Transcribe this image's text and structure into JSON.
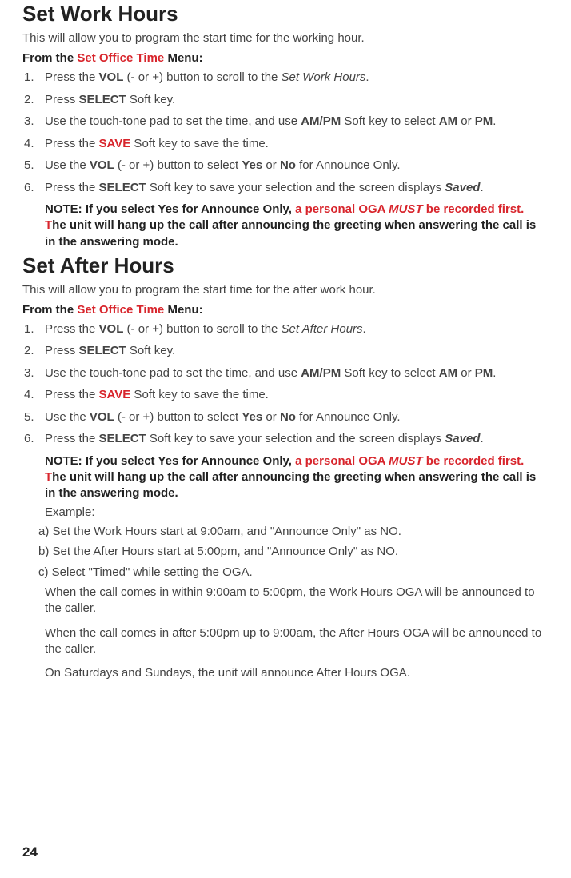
{
  "section1": {
    "title": "Set Work Hours",
    "intro": "This will allow you to program the start time for the working hour.",
    "menuFrom_pre": "From the ",
    "menuFrom_red": "Set Office Time",
    "menuFrom_post": " Menu:"
  },
  "s1_steps": {
    "s1": {
      "a": "Press the ",
      "b": "VOL",
      "c": " (- or +) button to scroll to the ",
      "d": "Set Work Hours",
      "e": "."
    },
    "s2": {
      "a": "Press ",
      "b": "SELECT",
      "c": " Soft key."
    },
    "s3": {
      "a": "Use the touch-tone pad to set the time, and use ",
      "b": "AM/PM",
      "c": " Soft key to select ",
      "d": "AM",
      "e": " or ",
      "f": "PM",
      "g": "."
    },
    "s4": {
      "a": "Press the ",
      "b": "SAVE",
      "c": " Soft key to save the time."
    },
    "s5": {
      "a": "Use the ",
      "b": "VOL",
      "c": " (- or +) button to select ",
      "d": "Yes",
      "e": " or ",
      "f": "No",
      "g": " for Announce Only."
    },
    "s6": {
      "a": "Press the ",
      "b": "SELECT",
      "c": " Soft key to save your selection and the screen displays ",
      "d": "Saved",
      "e": "."
    }
  },
  "note1": {
    "a": "NOTE: If you select Yes for Announce Only, ",
    "b": "a personal OGA ",
    "c": "MUST",
    "d": " be recorded first. T",
    "e": "he unit will hang up the call after announcing the greeting when answering the call is in the answering mode."
  },
  "section2": {
    "title": "Set After Hours",
    "intro": "This will allow you to program the start time for the after work hour.",
    "menuFrom_pre": "From the ",
    "menuFrom_red": "Set Office Time",
    "menuFrom_post": " Menu:"
  },
  "s2_steps": {
    "s1": {
      "a": "Press the ",
      "b": "VOL",
      "c": " (- or +) button to scroll to the ",
      "d": "Set After Hours",
      "e": "."
    },
    "s2": {
      "a": "Press ",
      "b": "SELECT",
      "c": " Soft key."
    },
    "s3": {
      "a": "Use the touch-tone pad to set the time, and use ",
      "b": "AM/PM",
      "c": " Soft key to select ",
      "d": "AM",
      "e": " or ",
      "f": "PM",
      "g": "."
    },
    "s4": {
      "a": "Press the ",
      "b": "SAVE",
      "c": " Soft key to save the time."
    },
    "s5": {
      "a": "Use the ",
      "b": "VOL",
      "c": " (- or +) button to select ",
      "d": "Yes",
      "e": " or ",
      "f": "No",
      "g": " for Announce Only."
    },
    "s6": {
      "a": "Press the ",
      "b": "SELECT",
      "c": " Soft key to save your selection and the screen displays ",
      "d": "Saved",
      "e": "."
    }
  },
  "note2": {
    "a": "NOTE: If you select Yes for Announce Only, ",
    "b": "a personal OGA ",
    "c": "MUST",
    "d": " be recorded first. T",
    "e": "he unit will hang up the call after announcing the greeting when answering the call is in the answering mode."
  },
  "example": {
    "label": "Example:",
    "a": "a) Set the Work Hours start at 9:00am, and \"Announce Only\" as NO.",
    "b": "b) Set the After Hours start at 5:00pm, and \"Announce Only\" as NO.",
    "c": "c) Select \"Timed\" while setting the OGA.",
    "p1": "When the call comes in within 9:00am to 5:00pm, the Work Hours OGA will be announced to the caller.",
    "p2": "When the call comes in after 5:00pm up to 9:00am, the After Hours OGA will be announced to the caller.",
    "p3": "On Saturdays and Sundays, the unit will announce After Hours OGA."
  },
  "pageNumber": "24"
}
